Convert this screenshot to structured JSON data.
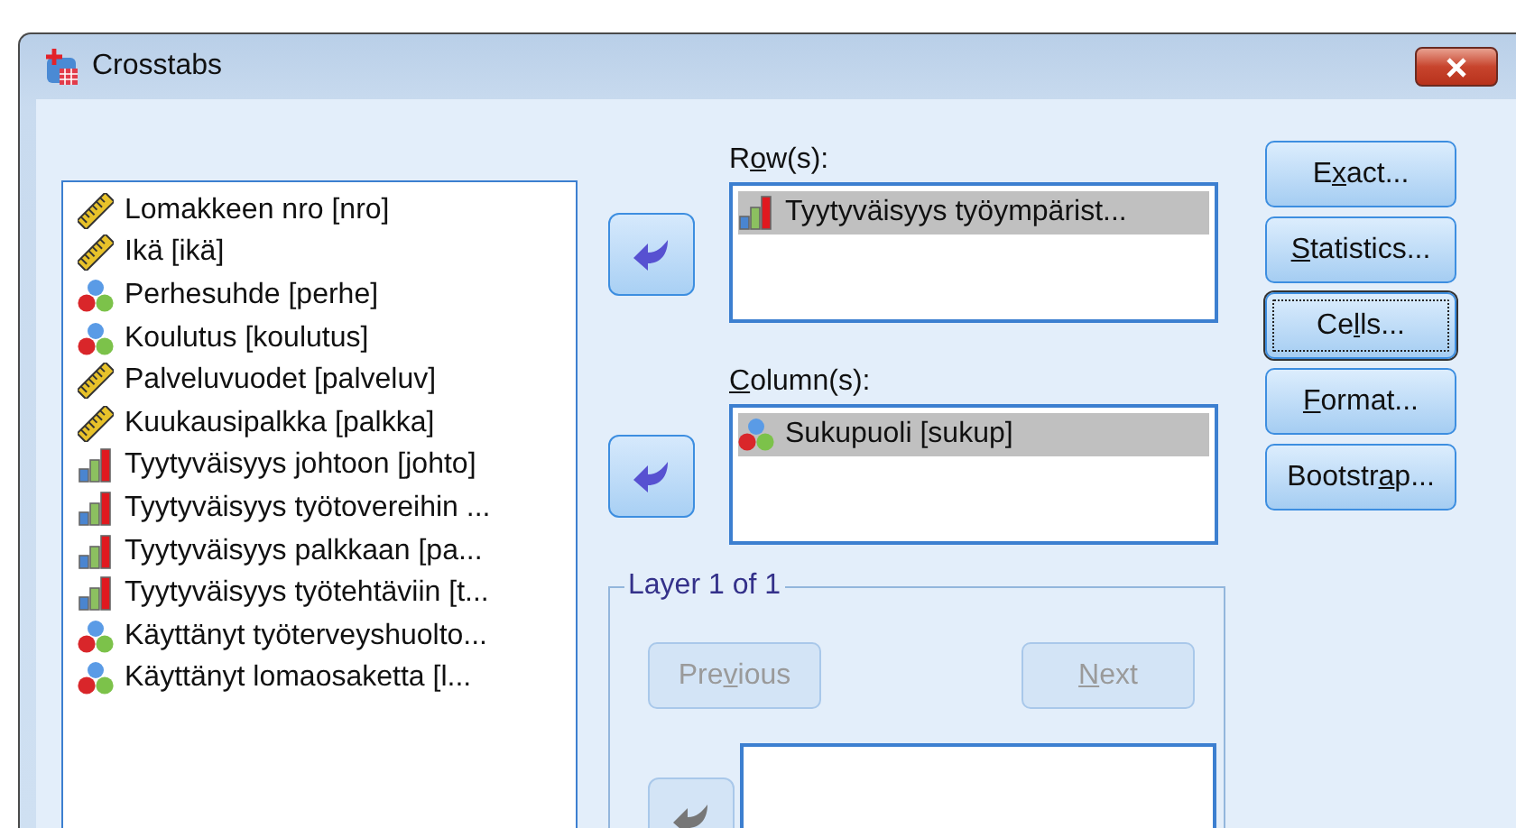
{
  "window": {
    "title": "Crosstabs"
  },
  "variables": [
    {
      "label": "Lomakkeen nro [nro]",
      "kind": "scale"
    },
    {
      "label": "Ikä [ikä]",
      "kind": "scale"
    },
    {
      "label": "Perhesuhde [perhe]",
      "kind": "nominal"
    },
    {
      "label": "Koulutus [koulutus]",
      "kind": "nominal"
    },
    {
      "label": "Palveluvuodet [palveluv]",
      "kind": "scale"
    },
    {
      "label": "Kuukausipalkka [palkka]",
      "kind": "scale"
    },
    {
      "label": "Tyytyväisyys johtoon [johto]",
      "kind": "ordinal"
    },
    {
      "label": "Tyytyväisyys työtovereihin ...",
      "kind": "ordinal"
    },
    {
      "label": "Tyytyväisyys palkkaan [pa...",
      "kind": "ordinal"
    },
    {
      "label": "Tyytyväisyys työtehtäviin [t...",
      "kind": "ordinal"
    },
    {
      "label": "Käyttänyt työterveyshuolto...",
      "kind": "nominal"
    },
    {
      "label": "Käyttänyt lomaosaketta [l...",
      "kind": "nominal"
    }
  ],
  "targets": [
    {
      "label": {
        "before": "R",
        "key": "o",
        "after": "w(s):"
      },
      "arrow_disabled": false,
      "items": [
        {
          "label": "Tyytyväisyys työympärist...",
          "kind": "ordinal",
          "selected": true
        }
      ]
    },
    {
      "label": {
        "key": "C",
        "after": "olumn(s):"
      },
      "arrow_disabled": false,
      "items": [
        {
          "label": "Sukupuoli [sukup]",
          "kind": "nominal",
          "selected": true
        }
      ]
    }
  ],
  "layer": {
    "title": "Layer 1 of 1",
    "arrow_disabled": true,
    "previous": {
      "label": {
        "before": "Pre",
        "key": "v",
        "after": "ious"
      },
      "disabled": true
    },
    "next": {
      "label": {
        "key": "N",
        "after": "ext"
      },
      "disabled": true
    }
  },
  "buttons": [
    {
      "label": {
        "before": "E",
        "key": "x",
        "after": "act..."
      },
      "focused": false
    },
    {
      "label": {
        "key": "S",
        "after": "tatistics..."
      },
      "focused": false
    },
    {
      "label": {
        "before": "Ce",
        "key": "l",
        "after": "ls..."
      },
      "focused": true
    },
    {
      "label": {
        "key": "F",
        "after": "ormat..."
      },
      "focused": false
    },
    {
      "label": {
        "before": "Bootstr",
        "key": "a",
        "after": "p..."
      },
      "focused": false
    }
  ]
}
